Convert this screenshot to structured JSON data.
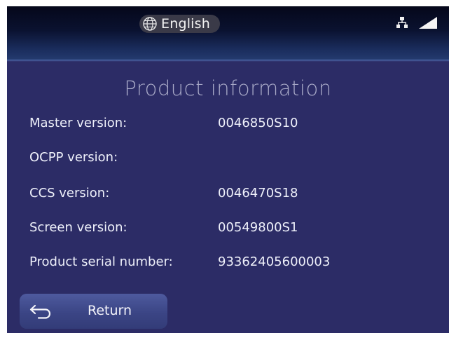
{
  "header": {
    "language": "English",
    "icons": [
      "globe-icon",
      "network-icon",
      "signal-icon"
    ]
  },
  "page": {
    "title": "Product information"
  },
  "info_rows": [
    {
      "label": "Master version:",
      "value": "0046850S10"
    },
    {
      "label": "OCPP version:",
      "value": ""
    },
    {
      "label": "CCS version:",
      "value": "0046470S18"
    },
    {
      "label": "Screen version:",
      "value": "00549800S1"
    },
    {
      "label": "Product serial number:",
      "value": "93362405600003"
    }
  ],
  "footer": {
    "return_label": "Return",
    "return_icon": "return-arrow-icon"
  },
  "colors": {
    "background": "#2c2c66",
    "header_dark": "#05071a",
    "header_accent": "#243a6e",
    "text": "#eef0fa",
    "title": "#a9aac8",
    "button": "#3b4585",
    "language_pill": "#3a3a48"
  }
}
